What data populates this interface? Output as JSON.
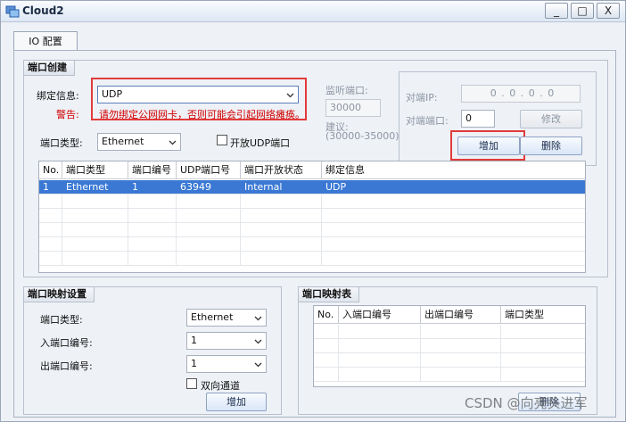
{
  "window": {
    "title": "Cloud2",
    "minimize_label": "_",
    "maximize_label": "□",
    "close_label": "X"
  },
  "tabs": [
    {
      "label": "IO 配置"
    }
  ],
  "port_create": {
    "title": "端口创建",
    "binding_label": "绑定信息:",
    "binding_value": "UDP",
    "warning_label": "警告:",
    "warning_text": "请勿绑定公网网卡，否则可能会引起网络瘫痪。",
    "port_type_label": "端口类型:",
    "port_type_value": "Ethernet",
    "open_udp_label": "开放UDP端口",
    "listen_port_label": "监听端口:",
    "listen_port_value": "30000",
    "suggest_label": "建议:",
    "suggest_range": "(30000-35000)",
    "peer_ip_label": "对端IP:",
    "peer_ip_value": "0 . 0 . 0 . 0",
    "peer_port_label": "对端端口:",
    "peer_port_value": "0",
    "modify_button": "修改",
    "add_button": "增加",
    "delete_button": "删除"
  },
  "port_table": {
    "columns": [
      "No.",
      "端口类型",
      "端口编号",
      "UDP端口号",
      "端口开放状态",
      "绑定信息"
    ],
    "rows": [
      [
        "1",
        "Ethernet",
        "1",
        "63949",
        "Internal",
        "UDP"
      ]
    ]
  },
  "port_mapping_settings": {
    "title": "端口映射设置",
    "port_type_label": "端口类型:",
    "port_type_value": "Ethernet",
    "in_port_label": "入端口编号:",
    "in_port_value": "1",
    "out_port_label": "出端口编号:",
    "out_port_value": "1",
    "bidirectional_label": "双向通道",
    "add_button": "增加"
  },
  "port_mapping_table": {
    "title": "端口映射表",
    "columns": [
      "No.",
      "入端口编号",
      "出端口编号",
      "端口类型"
    ],
    "delete_button": "删除"
  },
  "watermark": "CSDN @向亮头进军",
  "colors": {
    "highlight_box": "#e23b3b",
    "selected_row": "#3a78d4",
    "warning_text": "#d00000"
  }
}
